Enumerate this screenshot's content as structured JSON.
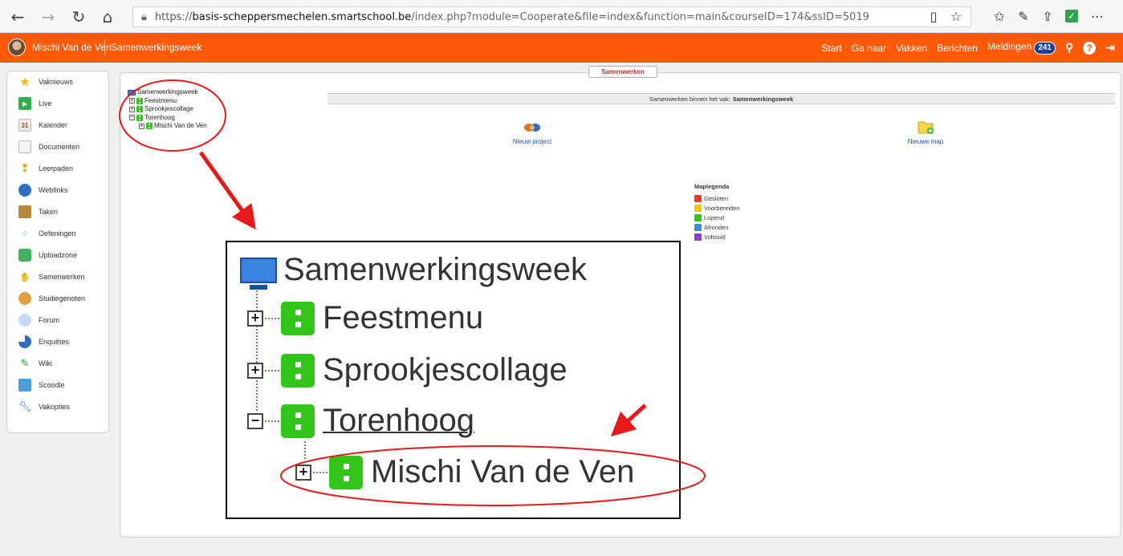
{
  "browser": {
    "url_prefix": "https://",
    "url_host": "basis-scheppersmechelen.smartschool.be",
    "url_path": "/index.php?module=Cooperate&file=index&function=main&courseID=174&ssID=5019"
  },
  "topbar": {
    "user_name": "Mischi Van de Ven",
    "course_name": "Samenwerkingsweek",
    "menu": [
      "Start",
      "Ga naar",
      "Vakken",
      "Berichten"
    ],
    "notifications_label": "Meldingen",
    "notifications_count": "241",
    "accent": "#ff5a0a"
  },
  "sidebar": {
    "items": [
      {
        "label": "Vaknieuws",
        "icon": "star-icon"
      },
      {
        "label": "Live",
        "icon": "live-icon"
      },
      {
        "label": "Kalender",
        "icon": "calendar-icon"
      },
      {
        "label": "Documenten",
        "icon": "document-icon"
      },
      {
        "label": "Leerpaden",
        "icon": "footsteps-icon"
      },
      {
        "label": "Weblinks",
        "icon": "globe-icon"
      },
      {
        "label": "Taken",
        "icon": "tasks-icon"
      },
      {
        "label": "Oefeningen",
        "icon": "exercises-icon"
      },
      {
        "label": "Uploadzone",
        "icon": "upload-icon"
      },
      {
        "label": "Samenwerken",
        "icon": "handshake-icon"
      },
      {
        "label": "Studiegenoten",
        "icon": "people-icon"
      },
      {
        "label": "Forum",
        "icon": "forum-icon"
      },
      {
        "label": "Enquêtes",
        "icon": "pie-icon"
      },
      {
        "label": "Wiki",
        "icon": "pencil-icon"
      },
      {
        "label": "Scoodle",
        "icon": "scoodle-icon"
      },
      {
        "label": "Vakopties",
        "icon": "wrench-icon"
      }
    ]
  },
  "main": {
    "tab_label": "Samenwerken",
    "info_prefix": "Samenwerken binnen het vak:",
    "info_course": "Samenwerkingsweek",
    "new_project": "Nieuw project",
    "new_folder": "Nieuwe map"
  },
  "tree": {
    "root": "Samenwerkingsweek",
    "items": [
      "Feestmenu",
      "Sprookjescollage",
      "Torenhoog"
    ],
    "child": "Mischi Van de Ven"
  },
  "legend": {
    "title": "Maplegenda",
    "items": [
      {
        "label": "Gesloten",
        "color": "#e8401c"
      },
      {
        "label": "Voorbereiden",
        "color": "#f2c500"
      },
      {
        "label": "Lopend",
        "color": "#33c41a"
      },
      {
        "label": "Afronden",
        "color": "#3a8fd8"
      },
      {
        "label": "Voltooid",
        "color": "#8a3ec9"
      }
    ]
  },
  "annotation_color": "#e8191b"
}
